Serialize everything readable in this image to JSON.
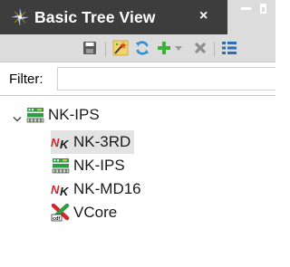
{
  "view": {
    "title": "Basic Tree View",
    "close_glyph": "×"
  },
  "icons": {
    "view_icon": "gear-pinwheel-icon",
    "toolbar": [
      "save-icon",
      "edit-wand-icon",
      "refresh-icon",
      "add-icon",
      "dropdown-arrow-icon",
      "delete-icon",
      "tree-layout-icon"
    ],
    "node_icons": {
      "board": "board-icon",
      "nk_device": "nk-device-icon",
      "vcore": "vcore-icon"
    }
  },
  "filter": {
    "label": "Filter:",
    "value": "",
    "placeholder": ""
  },
  "tree": {
    "root": {
      "label": "NK-IPS",
      "expanded": true
    },
    "children": [
      {
        "label": "NK-3RD",
        "selected": true
      },
      {
        "label": "NK-IPS",
        "selected": false
      },
      {
        "label": "NK-MD16",
        "selected": false
      },
      {
        "label": "VCore",
        "selected": false
      }
    ]
  },
  "colors": {
    "tab_active_bg": "#3d3d3d",
    "chrome_bg": "#dcdcdc",
    "selection_bg": "#e3e3e3",
    "add_green": "#3cb13c",
    "refresh_blue": "#2f8fd6"
  }
}
